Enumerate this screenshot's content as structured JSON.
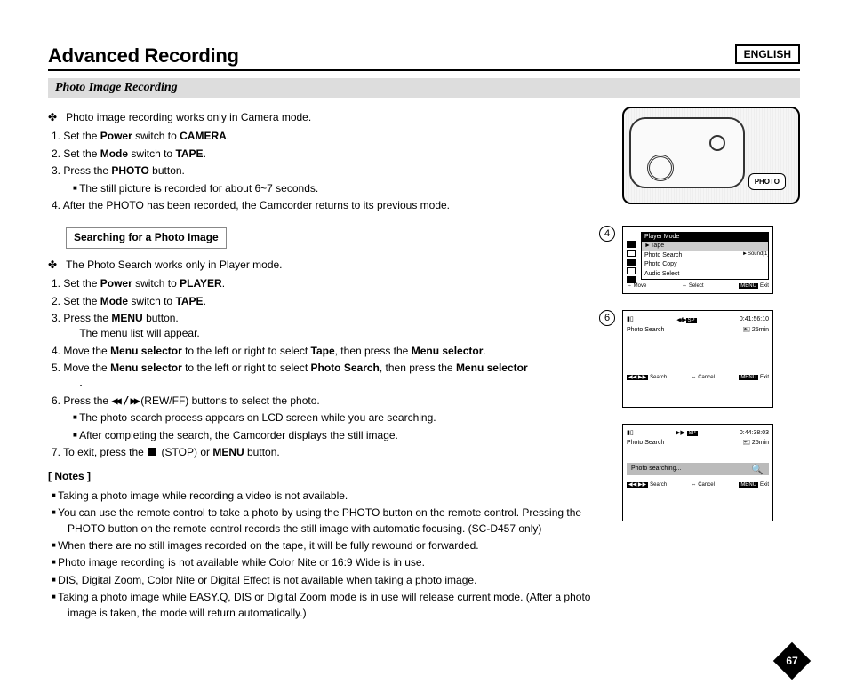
{
  "lang": "ENGLISH",
  "h1": "Advanced Recording",
  "section_title": "Photo Image Recording",
  "intro1": "Photo image recording works only in Camera mode.",
  "steps_a": [
    {
      "n": "1.",
      "text": "Set the ",
      "b1": "Power",
      "mid": " switch to ",
      "b2": "CAMERA",
      "end": "."
    },
    {
      "n": "2.",
      "text": "Set the ",
      "b1": "Mode",
      "mid": " switch to ",
      "b2": "TAPE",
      "end": "."
    },
    {
      "n": "3.",
      "text": "Press the ",
      "b1": "PHOTO",
      "mid": " button.",
      "b2": "",
      "end": ""
    }
  ],
  "steps_a_sub": "The still picture is recorded for about 6~7 seconds.",
  "steps_a_4": {
    "n": "4.",
    "text": "After the PHOTO has been recorded, the Camcorder returns to its previous mode."
  },
  "subheader": "Searching for a Photo Image",
  "intro2": "The Photo Search works only in Player mode.",
  "steps_b": [
    {
      "n": "1.",
      "text": "Set the ",
      "b1": "Power",
      "mid": " switch to ",
      "b2": "PLAYER",
      "end": "."
    },
    {
      "n": "2.",
      "text": "Set the ",
      "b1": "Mode",
      "mid": " switch to ",
      "b2": "TAPE",
      "end": "."
    },
    {
      "n": "3.",
      "text": "Press the ",
      "b1": "MENU",
      "mid": " button.",
      "b2": "",
      "end": "",
      "extra": "The menu list will appear."
    },
    {
      "n": "4.",
      "text": "Move the ",
      "b1": "Menu selector",
      "mid": " to the left or right to select ",
      "b2": "Tape",
      "end": ", then press the ",
      "b3": "Menu selector",
      "end2": "."
    },
    {
      "n": "5.",
      "text": "Move the ",
      "b1": "Menu selector",
      "mid": " to the left or right to select ",
      "b2": "Photo Search",
      "end": ", then press the ",
      "b3": "Menu selector",
      "end2": "."
    },
    {
      "n": "6.",
      "text": "Press the ",
      "rw": "◀◀ / ▶▶",
      "mid": " (REW/FF) buttons to select the photo."
    }
  ],
  "steps_b6_subs": [
    "The photo search process appears on LCD screen while you are searching.",
    "After completing the search, the Camcorder displays the still image."
  ],
  "steps_b7": {
    "n": "7.",
    "pre": "To exit, press the ",
    "mid": "(STOP) or ",
    "b1": "MENU",
    "end": " button."
  },
  "notes_header": "[ Notes ]",
  "notes": [
    "Taking a photo image while recording a video is not available.",
    "You can use the remote control to take a photo by using the PHOTO button on the remote control. Pressing the PHOTO button on the remote control records the still image with automatic focusing. (SC-D457 only)",
    "When there are no still images recorded on the tape, it will be fully rewound or forwarded.",
    "Photo image recording is not available while Color Nite or 16:9 Wide is in use.",
    "DIS, Digital Zoom, Color Nite or Digital Effect is not available when taking a photo image.",
    "Taking a photo image while EASY.Q, DIS or Digital Zoom mode is in use will release current mode. (After a photo image is taken, the mode will return automatically.)"
  ],
  "illus": {
    "button_label": "PHOTO"
  },
  "osd4": {
    "step": "4",
    "title": "Player Mode",
    "tape": "►Tape",
    "items": [
      "Photo Search",
      "Photo Copy",
      "Audio Select"
    ],
    "right": "►Sound[1]",
    "footer": {
      "a_icon": "⇔",
      "a": "Move",
      "b_icon": "⇔",
      "b": "Select",
      "c_tag": "MENU",
      "c": "Exit"
    }
  },
  "osd6a": {
    "step": "6",
    "rw": "◀◀ / ▶▶",
    "sp": "SP",
    "time": "0:41:56:10",
    "label": "Photo Search",
    "remain_icon": "🖭",
    "remain": "25min",
    "footer": {
      "a_tag": "◀◀ ▶▶",
      "a": "Search",
      "b_icon": "⇔",
      "b": "Cancel",
      "c_tag": "MENU",
      "c": "Exit"
    }
  },
  "osd6b": {
    "ff": "▶▶",
    "sp": "SP",
    "time": "0:44:38:03",
    "label": "Photo Search",
    "remain_icon": "🖭",
    "remain": "25min",
    "banner": "Photo searching...",
    "footer": {
      "a_tag": "◀◀ ▶▶",
      "a": "Search",
      "b_icon": "⇔",
      "b": "Cancel",
      "c_tag": "MENU",
      "c": "Exit"
    }
  },
  "page_number": "67"
}
